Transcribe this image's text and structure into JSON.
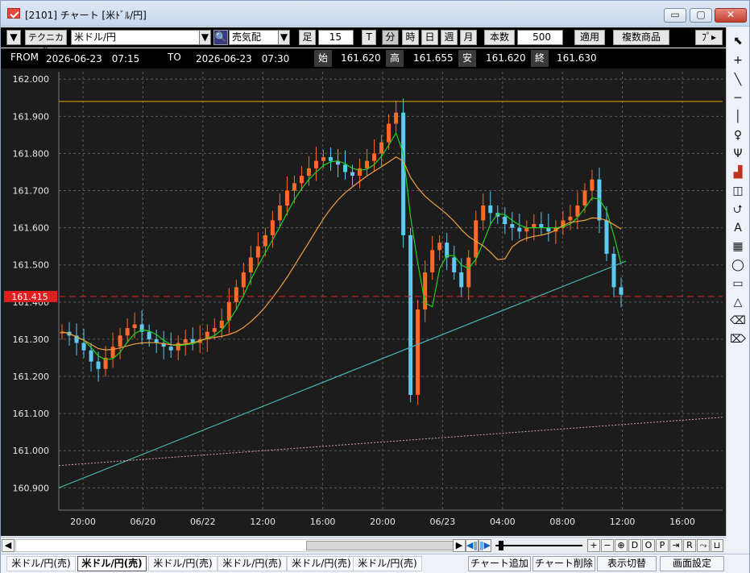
{
  "window": {
    "title": "[2101] チャート [米ﾄﾞﾙ/円]",
    "buttons": [
      "▭",
      "▢",
      "✕"
    ]
  },
  "toolbar": {
    "mode_dropdown": "▼",
    "technical_label": "テクニカル",
    "instrument": "米ドル/円",
    "side": "売気配",
    "bar_label": "足",
    "bar_count": "15",
    "timeframes": [
      "T",
      "分",
      "時",
      "日",
      "週",
      "月"
    ],
    "active_timeframe": "分",
    "count_label": "本数",
    "count_value": "500",
    "apply_label": "適用",
    "multi_label": "複数商品",
    "more_label": "ﾌﾟ▸"
  },
  "info": {
    "from_label": "FROM",
    "from_value": "2026-06-23　07:15",
    "to_label": "TO",
    "to_value": "2026-06-23　07:30",
    "open_label": "始",
    "open_value": "161.620",
    "high_label": "高",
    "high_value": "161.655",
    "low_label": "安",
    "low_value": "161.620",
    "close_label": "終",
    "close_value": "161.630"
  },
  "chart_data": {
    "type": "candlestick",
    "y_ticks": [
      "162.000",
      "161.900",
      "161.800",
      "161.700",
      "161.600",
      "161.500",
      "161.400",
      "161.300",
      "161.200",
      "161.100",
      "161.000",
      "160.900"
    ],
    "ylim": [
      160.84,
      162.02
    ],
    "x_ticks": [
      "20:00",
      "06/20",
      "06/22",
      "12:00",
      "16:00",
      "20:00",
      "06/23",
      "04:00",
      "08:00",
      "12:00",
      "16:00"
    ],
    "current_price": "161.415",
    "current_value": 161.415,
    "h_line_value": 161.94,
    "colors": {
      "up": "#ff6a2a",
      "down": "#5ec8f0",
      "ma_short": "#20d020",
      "ma_mid": "#f0a040",
      "ma_long": "#48b0b0",
      "ma_xlong": "#e0a0a0",
      "price_line": "#e02020",
      "h_line": "#e0b000",
      "grid": "#5a5a5a"
    },
    "series": [
      {
        "values": [
          161.32,
          161.31,
          161.29,
          161.27,
          161.24,
          161.22,
          161.25,
          161.28,
          161.31,
          161.33,
          161.34,
          161.32,
          161.3,
          161.29,
          161.28,
          161.27,
          161.29,
          161.3,
          161.29,
          161.3,
          161.32,
          161.33,
          161.35,
          161.4,
          161.44,
          161.48,
          161.52,
          161.55,
          161.58,
          161.62,
          161.66,
          161.7,
          161.72,
          161.74,
          161.76,
          161.78,
          161.79,
          161.78,
          161.77,
          161.75,
          161.74,
          161.76,
          161.78,
          161.8,
          161.83,
          161.88,
          161.91,
          161.58,
          161.15,
          161.38,
          161.48,
          161.54,
          161.56,
          161.52,
          161.48,
          161.44,
          161.52,
          161.62,
          161.66,
          161.64,
          161.63,
          161.61,
          161.6,
          161.59,
          161.6,
          161.61,
          161.6,
          161.59,
          161.6,
          161.62,
          161.63,
          161.66,
          161.7,
          161.73,
          161.62,
          161.53,
          161.44,
          161.42
        ]
      }
    ]
  },
  "palette": [
    "⬉",
    "+",
    "╲",
    "─",
    "│",
    "♀",
    "Ψ",
    "▟",
    "◫",
    "⮍",
    "A",
    "▦",
    "◯",
    "▭",
    "△",
    "⌫",
    "⌦"
  ],
  "scroll": {
    "buttons": [
      "◀",
      "▶",
      "◀‖",
      "‖▶",
      "+",
      "−",
      "⊕",
      "D",
      "O",
      "P",
      "⇥",
      "R",
      "⤳",
      "⊔"
    ]
  },
  "tabs": [
    "米ドル/円(売)",
    "米ドル/円(売)",
    "米ドル/円(売)",
    "米ドル/円(売)",
    "米ドル/円(売)",
    "米ドル/円(売)"
  ],
  "active_tab": 1,
  "actions": [
    "チャート追加",
    "チャート削除",
    "表示切替",
    "画面設定"
  ]
}
